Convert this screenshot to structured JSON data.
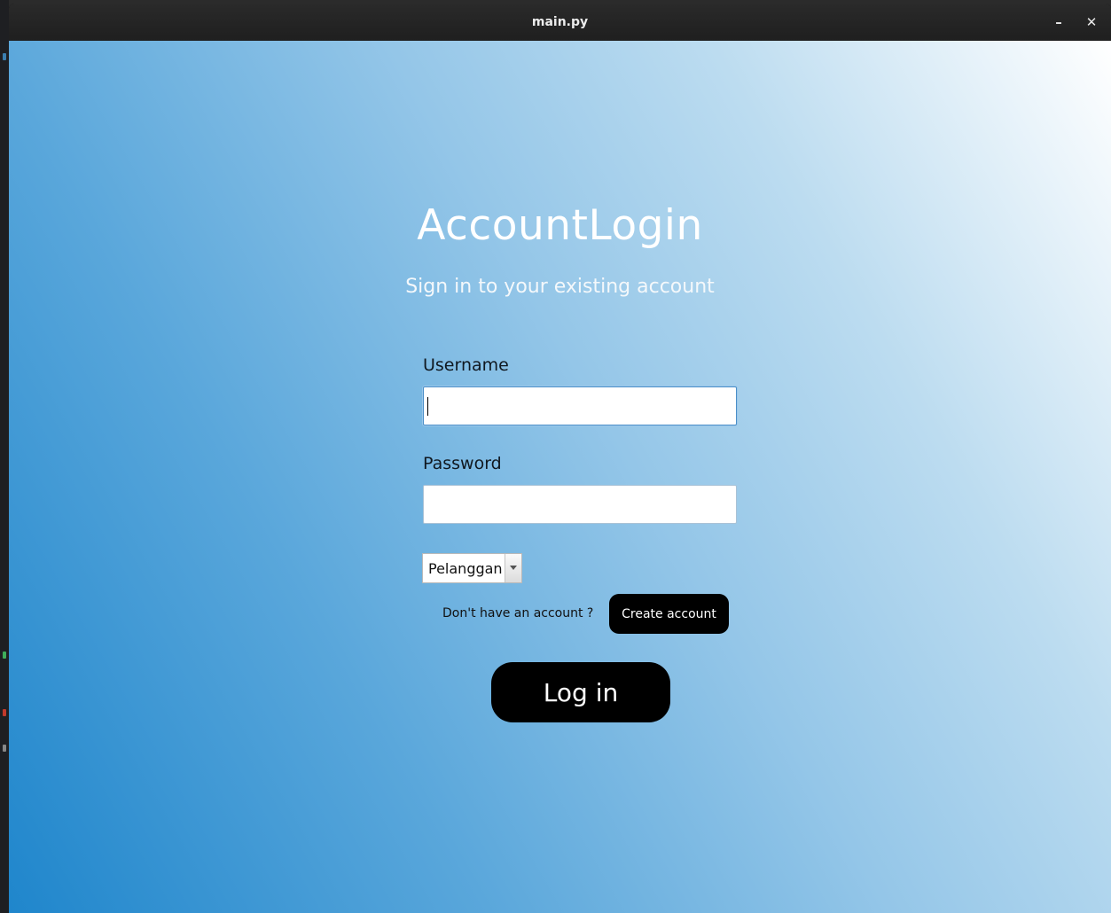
{
  "window": {
    "title": "main.py",
    "minimize_glyph": "–",
    "close_glyph": "✕"
  },
  "login": {
    "title": "AccountLogin",
    "subtitle": "Sign in to your existing account",
    "username_label": "Username",
    "username_value": "",
    "password_label": "Password",
    "password_value": "",
    "role_value": "Pelanggan",
    "no_account_text": "Don't have an account ?",
    "create_account_label": "Create account",
    "login_label": "Log in"
  },
  "colors": {
    "gradient_dark": "#1f86cc",
    "gradient_light": "#ffffff",
    "button_bg": "#000000",
    "button_text": "#ffffff"
  },
  "icons": {
    "minimize": "minimize-icon",
    "close": "close-icon",
    "dropdown": "chevron-down-icon"
  }
}
